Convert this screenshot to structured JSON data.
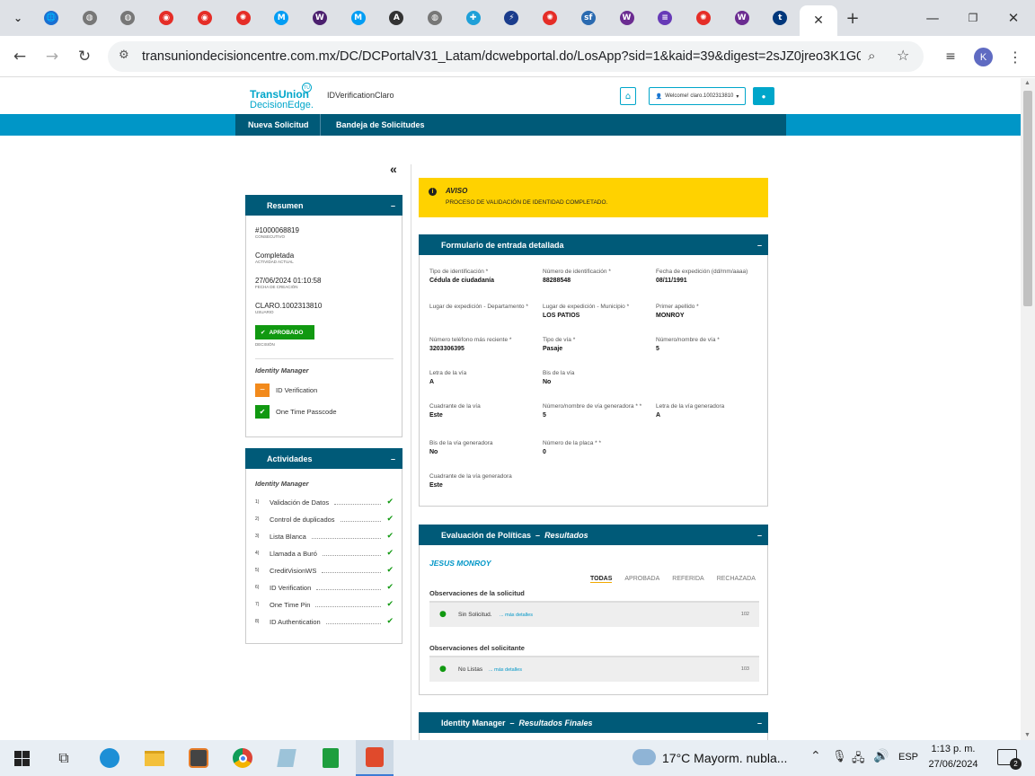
{
  "browser": {
    "tabs": [
      {
        "icon": "blue-globe-icon",
        "color": "#1a6fd1"
      },
      {
        "icon": "globe-icon",
        "color": "#777"
      },
      {
        "icon": "globe-icon",
        "color": "#777"
      },
      {
        "icon": "claro-red-icon",
        "color": "#e52d27"
      },
      {
        "icon": "claro-red-icon",
        "color": "#e52d27"
      },
      {
        "icon": "claro-sun-icon",
        "color": "#e52d27"
      },
      {
        "icon": "movistar-icon",
        "color": "#019df4"
      },
      {
        "icon": "wompi-circle-icon",
        "color": "#4b1f6e"
      },
      {
        "icon": "movistar-icon",
        "color": "#019df4"
      },
      {
        "icon": "angular-icon",
        "color": "#333"
      },
      {
        "icon": "globe-icon",
        "color": "#777"
      },
      {
        "icon": "plus-cross-icon",
        "color": "#1fa0d8"
      },
      {
        "icon": "runner-icon",
        "color": "#1a3c8c"
      },
      {
        "icon": "claro-sun-icon",
        "color": "#e52d27"
      },
      {
        "icon": "sf-icon",
        "color": "#2a6ab0"
      },
      {
        "icon": "wom-icon",
        "color": "#6b2c91"
      },
      {
        "icon": "forms-icon",
        "color": "#673ab7"
      },
      {
        "icon": "claro-sun-icon",
        "color": "#e52d27"
      },
      {
        "icon": "wom-icon",
        "color": "#6b2c91"
      },
      {
        "icon": "tigo-icon",
        "color": "#00377b"
      }
    ],
    "url": "transuniondecisioncentre.com.mx/DC/DCPortalV31_Latam/dcwebportal.do/LosApp?sid=1&kaid=39&digest=2sJZ0jreo3K1G0qvt...",
    "profile_initial": "K"
  },
  "header": {
    "logo_line1": "TransUnion",
    "logo_line2": "DecisionEdge.",
    "app_name": "IDVerificationClaro",
    "welcome": "Welcome! claro.1002313810"
  },
  "nav": {
    "items": [
      "Nueva Solicitud",
      "Bandeja de Solicitudes"
    ]
  },
  "resumen": {
    "title": "Resumen",
    "id": "#1000068819",
    "id_label": "CONSECUTIVO",
    "status": "Completada",
    "status_label": "ACTIVIDAD ACTUAL",
    "date": "27/06/2024 01:10:58",
    "date_label": "FECHA DE CREACIÓN",
    "user": "CLARO.1002313810",
    "user_label": "USUARIO",
    "decision": "APROBADO",
    "decision_label": "DECISIÓN",
    "im_title": "Identity Manager",
    "im_items": [
      "ID Verification",
      "One Time Passcode"
    ]
  },
  "actividades": {
    "title": "Actividades",
    "subtitle": "Identity Manager",
    "items": [
      {
        "n": "1)",
        "label": "Validación de Datos"
      },
      {
        "n": "2)",
        "label": "Control de duplicados"
      },
      {
        "n": "3)",
        "label": "Lista Blanca"
      },
      {
        "n": "4)",
        "label": "Llamada a Buró"
      },
      {
        "n": "5)",
        "label": "CreditVisionWS"
      },
      {
        "n": "6)",
        "label": "ID Verification"
      },
      {
        "n": "7)",
        "label": "One Time Pin"
      },
      {
        "n": "8)",
        "label": "ID Authentication"
      }
    ]
  },
  "aviso": {
    "title": "AVISO",
    "text": "PROCESO DE VALIDACIÓN DE IDENTIDAD COMPLETADO."
  },
  "formulario": {
    "title": "Formulario de entrada detallada",
    "fields": [
      {
        "label": "Tipo de identificación *",
        "value": "Cédula de ciudadanía"
      },
      {
        "label": "Número de identificación *",
        "value": "88288548"
      },
      {
        "label": "Fecha de expedición (dd/mm/aaaa)",
        "value": "08/11/1991"
      },
      {
        "label": "Lugar de expedición - Departamento *",
        "value": ""
      },
      {
        "label": "Lugar de expedición - Municipio *",
        "value": "LOS PATIOS"
      },
      {
        "label": "Primer apellido *",
        "value": "MONROY"
      },
      {
        "label": "Número teléfono más reciente *",
        "value": "3203306395"
      },
      {
        "label": "Tipo de vía *",
        "value": "Pasaje"
      },
      {
        "label": "Número/nombre de vía *",
        "value": "5"
      },
      {
        "label": "Letra de la vía",
        "value": "A"
      },
      {
        "label": "Bis de la vía",
        "value": "No"
      },
      {
        "label": "Cuadrante de la vía",
        "value": "Este"
      },
      {
        "label": "Número/nombre de vía generadora * *",
        "value": "5"
      },
      {
        "label": "Letra de la vía generadora",
        "value": "A"
      },
      {
        "label": "Bis de la vía generadora",
        "value": "No"
      },
      {
        "label": "Número de la placa * *",
        "value": "0"
      },
      {
        "label": "Cuadrante de la vía generadora",
        "value": "Este"
      }
    ]
  },
  "evaluacion": {
    "title": "Evaluación de Políticas",
    "subtitle": "Resultados",
    "name": "JESUS MONROY",
    "filters": [
      "TODAS",
      "APROBADA",
      "REFERIDA",
      "RECHAZADA"
    ],
    "obs_solicitud_title": "Observaciones de la solicitud",
    "obs_solicitud": {
      "text": "Sin Solicitud.",
      "link": "... más detalles",
      "code": "102"
    },
    "obs_solicitante_title": "Observaciones del solicitante",
    "obs_solicitante": {
      "text": "No Listas",
      "link": "... más detalles",
      "code": "103"
    }
  },
  "idm": {
    "title": "Identity Manager",
    "subtitle": "Resultados Finales"
  },
  "taskbar": {
    "weather": "17°C  Mayorm. nubla...",
    "lang": "ESP",
    "time": "1:13 p. m.",
    "date": "27/06/2024",
    "notifications": "2"
  }
}
